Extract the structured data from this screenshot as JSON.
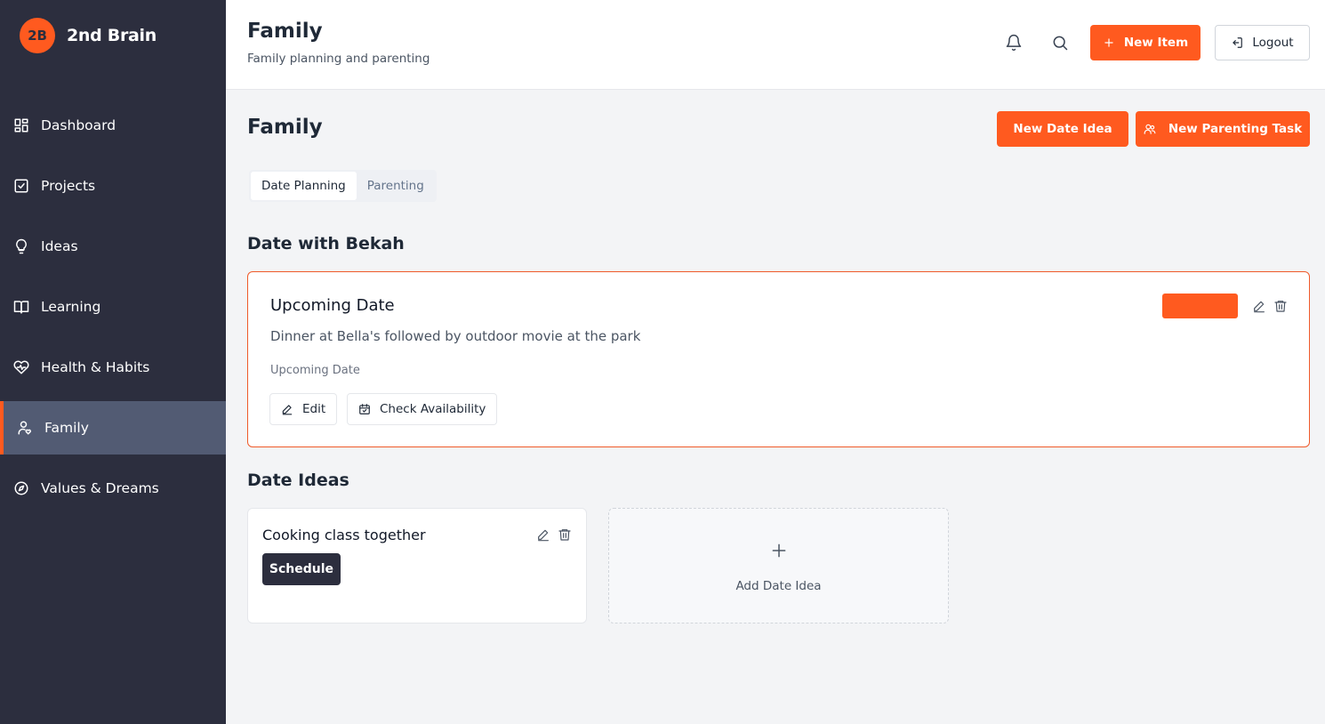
{
  "app": {
    "logo_text": "2B",
    "name": "2nd Brain"
  },
  "sidebar": {
    "items": [
      {
        "label": "Dashboard",
        "icon": "dashboard-icon"
      },
      {
        "label": "Projects",
        "icon": "checkbox-icon"
      },
      {
        "label": "Ideas",
        "icon": "lightbulb-icon"
      },
      {
        "label": "Learning",
        "icon": "book-icon"
      },
      {
        "label": "Health & Habits",
        "icon": "heart-pulse-icon"
      },
      {
        "label": "Family",
        "icon": "user-heart-icon",
        "active": true
      },
      {
        "label": "Values & Dreams",
        "icon": "compass-icon"
      }
    ]
  },
  "header": {
    "title": "Family",
    "subtitle": "Family planning and parenting",
    "new_item_label": "New Item",
    "logout_label": "Logout",
    "icons": [
      "bell-icon",
      "search-icon"
    ]
  },
  "main": {
    "title": "Family",
    "new_date_idea_label": "New Date Idea",
    "new_parenting_task_label": "New Parenting Task",
    "tabs": [
      {
        "label": "Date Planning",
        "active": true
      },
      {
        "label": "Parenting",
        "active": false
      }
    ],
    "date_section_title": "Date with Bekah",
    "upcoming": {
      "title": "Upcoming Date",
      "description": "Dinner at Bella's followed by outdoor movie at the park",
      "meta": "Upcoming Date",
      "edit_label": "Edit",
      "check_label": "Check Availability"
    },
    "ideas_section_title": "Date Ideas",
    "ideas": [
      {
        "title": "Cooking class together",
        "action_label": "Schedule"
      }
    ],
    "add_idea_label": "Add Date Idea"
  },
  "colors": {
    "accent": "#ff5a1f",
    "sidebar_bg": "#2c2e3e",
    "sidebar_active": "#525b73"
  }
}
